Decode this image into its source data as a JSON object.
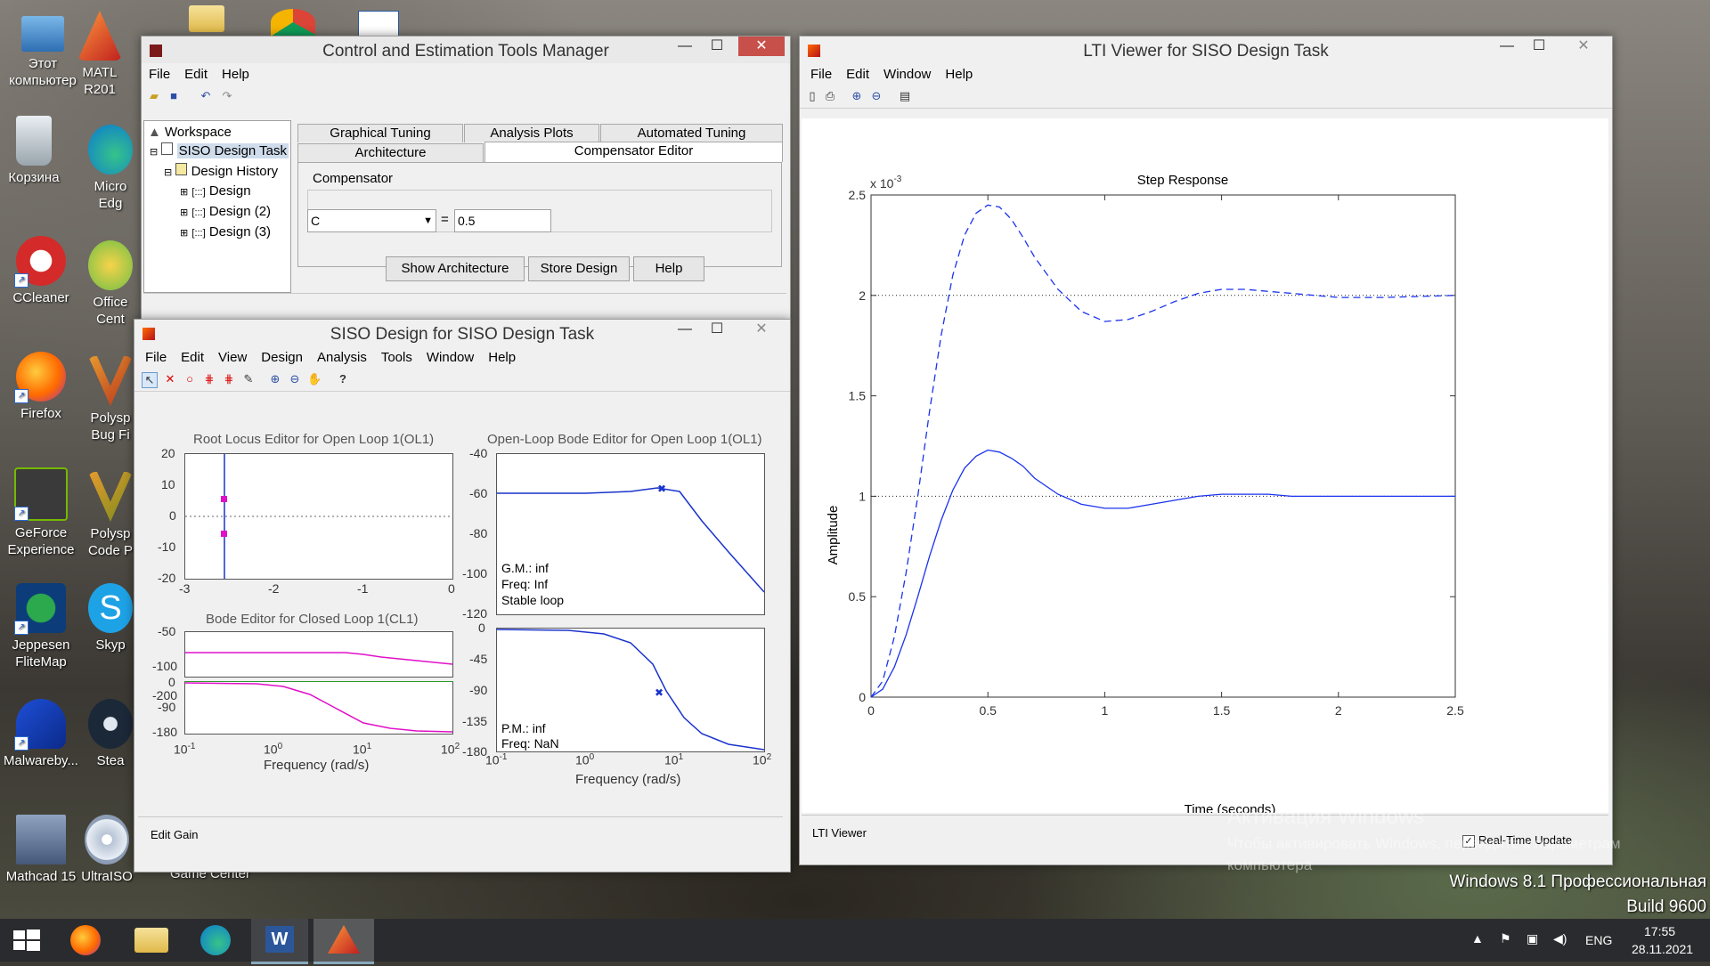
{
  "desktop": {
    "icons": [
      {
        "label": "Этот компьютер",
        "icon": "computer-icon"
      },
      {
        "label": "Корзина",
        "icon": "recycle-bin-icon"
      },
      {
        "label": "CCleaner",
        "icon": "ccleaner-icon"
      },
      {
        "label": "Firefox",
        "icon": "firefox-icon"
      },
      {
        "label": "GeForce Experience",
        "icon": "geforce-icon"
      },
      {
        "label": "Jeppesen FliteMap",
        "icon": "jeppesen-icon"
      },
      {
        "label": "Malwareby...",
        "icon": "malwarebytes-icon"
      },
      {
        "label": "Mathcad 15",
        "icon": "mathcad-icon"
      },
      {
        "label": "MATL R201",
        "icon": "matlab-icon"
      },
      {
        "label": "Micro Edg",
        "icon": "edge-icon"
      },
      {
        "label": "Office Cent",
        "icon": "office-icon"
      },
      {
        "label": "Polysp Bug Fi",
        "icon": "polyspace-icon"
      },
      {
        "label": "Polysp Code P",
        "icon": "polyspace-icon"
      },
      {
        "label": "Skyp",
        "icon": "skype-icon"
      },
      {
        "label": "Stea",
        "icon": "steam-icon"
      },
      {
        "label": "UltraISO",
        "icon": "ultraiso-icon"
      },
      {
        "label": "Game Center",
        "icon": "game-center-icon"
      }
    ]
  },
  "cetm": {
    "title": "Control and Estimation Tools Manager",
    "menu": [
      "File",
      "Edit",
      "Help"
    ],
    "tree": {
      "workspace": "Workspace",
      "task": "SISO Design Task",
      "history": "Design History",
      "designs": [
        "Design",
        "Design (2)",
        "Design (3)"
      ]
    },
    "tabs_top": [
      "Graphical Tuning",
      "Analysis Plots",
      "Automated Tuning"
    ],
    "tabs_bottom": [
      "Architecture",
      "Compensator Editor"
    ],
    "compensator_label": "Compensator",
    "compensator_select": "C",
    "equals": "=",
    "compensator_value": "0.5",
    "buttons": [
      "Show Architecture",
      "Store Design",
      "Help"
    ]
  },
  "siso": {
    "title": "SISO Design for SISO Design Task",
    "menu": [
      "File",
      "Edit",
      "View",
      "Design",
      "Analysis",
      "Tools",
      "Window",
      "Help"
    ],
    "status": "Edit Gain",
    "rl": {
      "title": "Root Locus Editor for Open Loop 1(OL1)",
      "yticks": [
        "20",
        "10",
        "0",
        "-10",
        "-20"
      ],
      "xticks": [
        "-3",
        "-2",
        "-1",
        "0"
      ]
    },
    "olb": {
      "title": "Open-Loop Bode Editor for Open Loop 1(OL1)",
      "mag_ticks": [
        "-40",
        "-60",
        "-80",
        "-100",
        "-120"
      ],
      "phase_ticks": [
        "0",
        "-45",
        "-90",
        "-135",
        "-180"
      ],
      "mag_note": [
        "G.M.: inf",
        "Freq: Inf",
        "Stable loop"
      ],
      "phase_note": [
        "P.M.: inf",
        "Freq: NaN"
      ],
      "xlabel": "Frequency (rad/s)"
    },
    "clb": {
      "title": "Bode Editor for Closed Loop 1(CL1)",
      "mag_ticks": [
        "-50",
        "-100",
        "-200"
      ],
      "phase_ticks": [
        "0",
        "-90",
        "-180"
      ],
      "xlabel": "Frequency (rad/s)"
    },
    "freq_ticks": [
      "10",
      "10",
      "10",
      "10"
    ],
    "freq_exps": [
      "-1",
      "0",
      "1",
      "2"
    ]
  },
  "lti": {
    "title": "LTI Viewer for SISO Design Task",
    "menu": [
      "File",
      "Edit",
      "Window",
      "Help"
    ],
    "status": "LTI Viewer",
    "realtime": "Real-Time Update"
  },
  "chart_data": {
    "type": "line",
    "title": "Step Response",
    "xlabel": "Time (seconds)",
    "ylabel": "Amplitude",
    "y_multiplier": "x 10",
    "y_multiplier_exp": "-3",
    "xlim": [
      0,
      2.5
    ],
    "ylim": [
      0,
      2.5
    ],
    "xticks": [
      "0",
      "0.5",
      "1",
      "1.5",
      "2",
      "2.5"
    ],
    "yticks": [
      "0",
      "0.5",
      "1",
      "1.5",
      "2",
      "2.5"
    ],
    "series": [
      {
        "style": "dashed",
        "x": [
          0,
          0.05,
          0.1,
          0.15,
          0.2,
          0.25,
          0.3,
          0.35,
          0.4,
          0.45,
          0.5,
          0.55,
          0.6,
          0.65,
          0.7,
          0.8,
          0.9,
          1.0,
          1.1,
          1.2,
          1.3,
          1.4,
          1.5,
          1.6,
          1.7,
          1.8,
          1.9,
          2.0,
          2.2,
          2.5
        ],
        "y": [
          0,
          0.08,
          0.3,
          0.62,
          1.0,
          1.42,
          1.8,
          2.1,
          2.3,
          2.41,
          2.45,
          2.44,
          2.38,
          2.29,
          2.19,
          2.03,
          1.92,
          1.87,
          1.88,
          1.92,
          1.97,
          2.01,
          2.03,
          2.03,
          2.02,
          2.01,
          2.0,
          1.99,
          1.99,
          2.0
        ]
      },
      {
        "style": "solid",
        "x": [
          0,
          0.05,
          0.1,
          0.15,
          0.2,
          0.25,
          0.3,
          0.35,
          0.4,
          0.45,
          0.5,
          0.55,
          0.6,
          0.65,
          0.7,
          0.8,
          0.9,
          1.0,
          1.1,
          1.2,
          1.3,
          1.4,
          1.5,
          1.6,
          1.7,
          1.8,
          1.9,
          2.0,
          2.2,
          2.5
        ],
        "y": [
          0,
          0.04,
          0.15,
          0.31,
          0.5,
          0.7,
          0.88,
          1.03,
          1.14,
          1.2,
          1.23,
          1.22,
          1.19,
          1.15,
          1.09,
          1.01,
          0.96,
          0.94,
          0.94,
          0.96,
          0.98,
          1.0,
          1.01,
          1.01,
          1.01,
          1.0,
          1.0,
          1.0,
          1.0,
          1.0
        ]
      }
    ],
    "reference_lines": [
      1,
      2
    ]
  },
  "watermark": {
    "line1": "Активация Windows",
    "line2": "Чтобы активировать Windows, перейдите к параметрам",
    "line3": "компьютера"
  },
  "os": {
    "edition": "Windows 8.1 Профессиональная",
    "build": "Build 9600"
  },
  "taskbar": {
    "lang": "ENG",
    "time": "17:55",
    "date": "28.11.2021"
  }
}
